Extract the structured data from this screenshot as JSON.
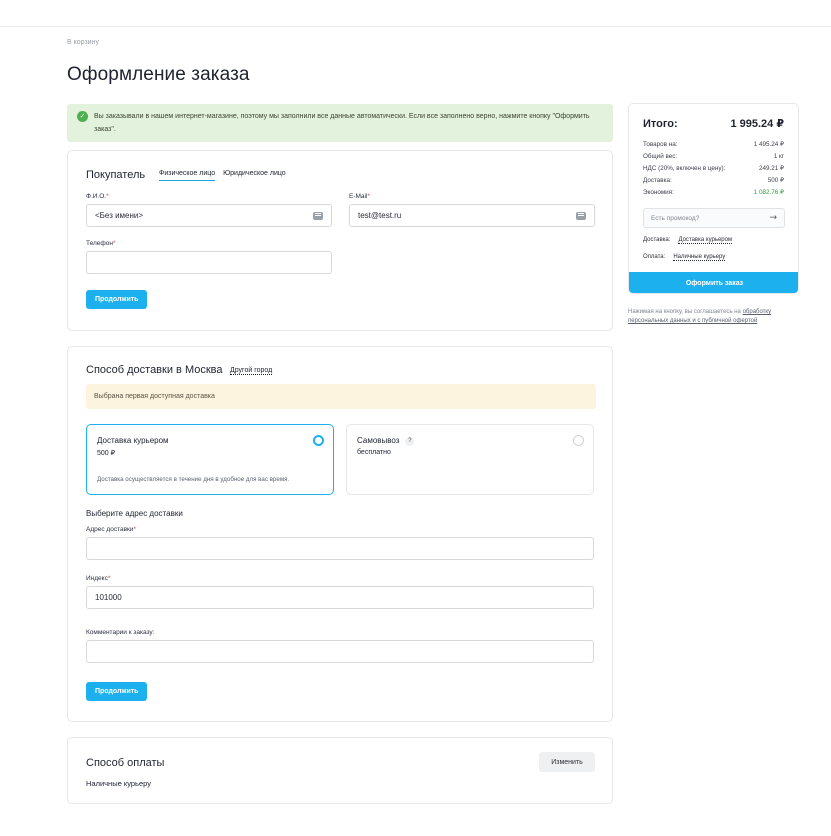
{
  "breadcrumb": "В корзину",
  "title": "Оформление заказа",
  "notice": {
    "text": "Вы заказывали в нашем интернет-магазине, поэтому мы заполнили все данные автоматически. Если все заполнено верно, нажмите кнопку \"Оформить заказ\"."
  },
  "buyer": {
    "title": "Покупатель",
    "tabs": [
      "Физическое лицо",
      "Юридическое лицо"
    ],
    "active_tab": "Физическое лицо",
    "fio_label": "Ф.И.О.",
    "fio_value": "<Без имени>",
    "email_label": "E-Mail",
    "email_value": "test@test.ru",
    "phone_label": "Телефон",
    "phone_value": "",
    "required_mark": "*",
    "continue": "Продолжить"
  },
  "delivery": {
    "title": "Способ доставки в Москва",
    "other_city": "Другой город",
    "warning": "Выбрана первая доступная доставка",
    "options": [
      {
        "name": "Доставка курьером",
        "price": "500 ₽",
        "desc": "Доставка осуществляется в течение дня в удобное для вас время.",
        "selected": true
      },
      {
        "name": "Самовывоз",
        "price": "бесплатно",
        "help": "?",
        "selected": false
      }
    ],
    "address_title": "Выберите адрес доставки",
    "address_label": "Адрес доставки",
    "address_value": "",
    "index_label": "Индекс",
    "index_value": "101000",
    "comment_label": "Комментарии к заказу:",
    "comment_value": "",
    "continue": "Продолжить"
  },
  "payment": {
    "title": "Способ оплаты",
    "change": "Изменить",
    "method": "Наличные курьеру"
  },
  "summary": {
    "total_label": "Итого:",
    "total_value": "1 995.24 ₽",
    "rows": [
      {
        "label": "Товаров на:",
        "value": "1 495.24 ₽"
      },
      {
        "label": "Общий вес:",
        "value": "1 кг"
      },
      {
        "label": "НДС (20%, включен в цену):",
        "value": "249.21 ₽"
      },
      {
        "label": "Доставка:",
        "value": "500 ₽"
      },
      {
        "label": "Экономия:",
        "value": "1 082.76 ₽"
      }
    ],
    "promo_placeholder": "Есть промокод?",
    "delivery_label": "Доставка:",
    "delivery_value": "Доставка курьером",
    "payment_label": "Оплата:",
    "payment_value": "Наличные курьеру",
    "order_button": "Оформить заказ",
    "agree_text": "Нажимая на кнопку, вы соглашаетесь на",
    "agree_link": "обработку персональных данных и с публичной офертой",
    "savings_color": "#2a9d3a",
    "accent_color": "#1cb0ef"
  }
}
